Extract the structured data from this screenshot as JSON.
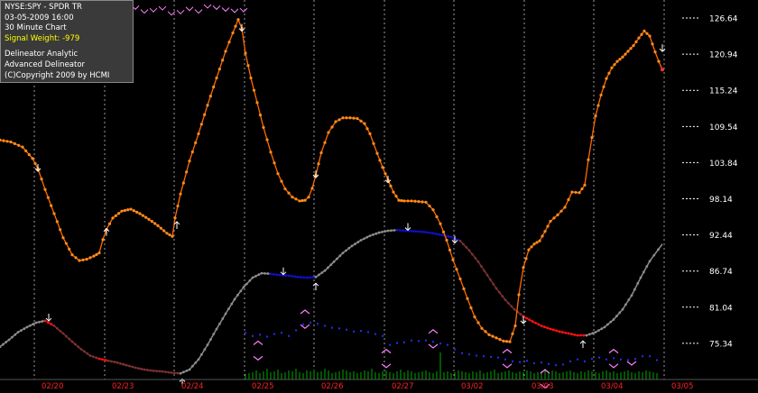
{
  "info": {
    "symbol": "NYSE:SPY - SPDR TR",
    "datetime": "03-05-2009  16:00",
    "interval": "30 Minute Chart",
    "signal_weight": "Signal Weight: -979",
    "line1": "Delineator Analytic",
    "line2": "Advanced Delineator",
    "copyright": "(C)Copyright 2009 by  HCMI"
  },
  "colors": {
    "background": "#000000",
    "price": "#ff6a00",
    "price_marker": "#ff8c1a",
    "delineator_grey": "#8c8c8c",
    "delineator_blue": "#1010c8",
    "delineator_red": "#ff1010",
    "delineator_brown": "#7a3030",
    "date_label": "#ff2020",
    "volume": "#00aa00",
    "arrow": "#ffffff",
    "chevron": "#ff80ff"
  },
  "chart_data": {
    "type": "line",
    "y_ticks": [
      "126.64",
      "120.94",
      "115.24",
      "109.54",
      "103.84",
      "98.14",
      "92.44",
      "86.74",
      "81.04",
      "75.34"
    ],
    "ylim": [
      69.64,
      129.49
    ],
    "xlim": [
      0,
      740
    ],
    "x_labels": [
      "02/20",
      "02/23",
      "02/24",
      "02/25",
      "02/26",
      "02/27",
      "03/02",
      "03/03",
      "03/04",
      "03/05"
    ],
    "day_boundaries": [
      38,
      116,
      193,
      271,
      348,
      426,
      503,
      581,
      658,
      736
    ],
    "price_series": {
      "x": [
        0,
        12,
        25,
        36,
        42,
        50,
        60,
        70,
        80,
        88,
        96,
        104,
        110,
        114,
        118,
        125,
        135,
        145,
        155,
        165,
        175,
        185,
        191,
        194,
        200,
        210,
        220,
        230,
        240,
        250,
        258,
        264,
        268,
        272,
        278,
        285,
        292,
        300,
        308,
        316,
        324,
        332,
        338,
        342,
        346,
        350,
        356,
        364,
        372,
        380,
        388,
        396,
        404,
        410,
        418,
        424,
        430,
        436,
        442,
        448,
        456,
        464,
        472,
        480,
        488,
        495,
        502,
        510,
        518,
        526,
        534,
        542,
        550,
        558,
        565,
        571,
        575,
        580,
        586,
        592,
        598,
        604,
        610,
        618,
        626,
        634,
        642,
        648,
        652,
        656,
        660,
        666,
        672,
        678,
        684,
        690,
        696,
        702,
        708,
        714,
        720,
        726,
        730,
        734
      ],
      "y": [
        107.4,
        107.1,
        106.3,
        104.5,
        102.9,
        99.6,
        95.8,
        92.0,
        89.3,
        88.4,
        88.6,
        89.1,
        89.6,
        91.7,
        93.3,
        95.1,
        96.2,
        96.5,
        95.8,
        94.9,
        93.9,
        92.7,
        92.2,
        95.1,
        98.9,
        104.1,
        108.4,
        112.9,
        117.2,
        121.4,
        124.3,
        126.4,
        125.0,
        121.1,
        117.2,
        113.3,
        109.4,
        105.5,
        102.1,
        99.7,
        98.4,
        97.8,
        97.9,
        98.4,
        99.8,
        101.9,
        105.4,
        108.6,
        110.3,
        110.9,
        110.9,
        110.8,
        110.0,
        108.4,
        105.3,
        103.1,
        101.1,
        99.2,
        97.9,
        97.8,
        97.8,
        97.7,
        97.6,
        96.4,
        94.2,
        91.6,
        88.5,
        85.5,
        82.4,
        79.5,
        77.7,
        76.7,
        76.2,
        75.7,
        75.6,
        78.1,
        83.0,
        87.3,
        90.1,
        91.0,
        91.5,
        93.0,
        94.6,
        95.6,
        96.8,
        99.2,
        99.1,
        100.3,
        104.3,
        107.8,
        111.2,
        114.5,
        117.1,
        118.8,
        119.8,
        120.5,
        121.4,
        122.3,
        123.5,
        124.6,
        123.8,
        121.3,
        119.8,
        118.5
      ]
    },
    "delineator_series": {
      "x": [
        0,
        10,
        20,
        30,
        40,
        50,
        60,
        70,
        80,
        90,
        100,
        110,
        120,
        130,
        140,
        150,
        160,
        170,
        180,
        190,
        200,
        210,
        220,
        230,
        240,
        250,
        260,
        270,
        280,
        290,
        300,
        310,
        320,
        330,
        340,
        350,
        360,
        370,
        380,
        390,
        400,
        410,
        420,
        430,
        440,
        450,
        460,
        470,
        480,
        490,
        500,
        510,
        520,
        530,
        540,
        550,
        560,
        570,
        580,
        590,
        600,
        610,
        620,
        630,
        640,
        650,
        660,
        670,
        680,
        690,
        700,
        710,
        720,
        734
      ],
      "y": [
        74.8,
        75.9,
        77.1,
        77.9,
        78.6,
        78.9,
        78.1,
        76.9,
        75.6,
        74.4,
        73.4,
        72.9,
        72.6,
        72.3,
        71.9,
        71.5,
        71.2,
        71.0,
        70.9,
        70.7,
        70.6,
        71.2,
        72.8,
        75.1,
        77.6,
        80.0,
        82.3,
        84.2,
        85.7,
        86.4,
        86.3,
        86.1,
        86.0,
        85.8,
        85.7,
        85.8,
        86.8,
        88.2,
        89.6,
        90.7,
        91.6,
        92.3,
        92.8,
        93.1,
        93.2,
        93.1,
        93.0,
        92.9,
        92.7,
        92.4,
        92.1,
        91.5,
        90.0,
        88.2,
        86.1,
        84.0,
        82.2,
        80.7,
        79.6,
        78.8,
        78.1,
        77.6,
        77.2,
        76.9,
        76.6,
        76.6,
        77.1,
        77.9,
        79.1,
        80.7,
        82.9,
        85.7,
        88.3,
        91.0
      ],
      "segment_colors": [
        "#8c8c8c",
        "#8c8c8c",
        "#8c8c8c",
        "#8c8c8c",
        "#8c8c8c",
        "#ff1010",
        "#7a3030",
        "#7a3030",
        "#7a3030",
        "#7a3030",
        "#7a3030",
        "#ff1010",
        "#7a3030",
        "#7a3030",
        "#7a3030",
        "#7a3030",
        "#7a3030",
        "#7a3030",
        "#7a3030",
        "#7a3030",
        "#8c8c8c",
        "#8c8c8c",
        "#8c8c8c",
        "#8c8c8c",
        "#8c8c8c",
        "#8c8c8c",
        "#8c8c8c",
        "#8c8c8c",
        "#8c8c8c",
        "#8c8c8c",
        "#1010c8",
        "#1010c8",
        "#1010c8",
        "#1010c8",
        "#1010c8",
        "#8c8c8c",
        "#8c8c8c",
        "#8c8c8c",
        "#8c8c8c",
        "#8c8c8c",
        "#8c8c8c",
        "#8c8c8c",
        "#8c8c8c",
        "#8c8c8c",
        "#1010c8",
        "#1010c8",
        "#1010c8",
        "#1010c8",
        "#1010c8",
        "#1010c8",
        "#1010c8",
        "#7a3030",
        "#7a3030",
        "#7a3030",
        "#7a3030",
        "#7a3030",
        "#7a3030",
        "#7a3030",
        "#ff1010",
        "#ff1010",
        "#ff1010",
        "#ff1010",
        "#ff1010",
        "#ff1010",
        "#ff1010",
        "#8c8c8c",
        "#8c8c8c",
        "#8c8c8c",
        "#8c8c8c",
        "#8c8c8c",
        "#8c8c8c",
        "#8c8c8c",
        "#8c8c8c"
      ]
    },
    "blue_dots": {
      "x": [
        272,
        280,
        288,
        296,
        304,
        312,
        320,
        328,
        336,
        344,
        352,
        360,
        368,
        376,
        384,
        392,
        400,
        408,
        416,
        424,
        432,
        440,
        448,
        456,
        464,
        472,
        480,
        488,
        496,
        504,
        512,
        520,
        528,
        536,
        544,
        552,
        560,
        568,
        576,
        584,
        592,
        600,
        608,
        616,
        624,
        632,
        640,
        648,
        656,
        664,
        672,
        680,
        688,
        696,
        704,
        712,
        720,
        728
      ],
      "y": [
        77.0,
        76.5,
        76.7,
        76.4,
        76.8,
        77.0,
        76.5,
        77.4,
        78.3,
        78.6,
        78.4,
        78.1,
        77.8,
        77.7,
        77.5,
        77.2,
        77.3,
        77.1,
        76.8,
        76.5,
        75.1,
        75.4,
        75.5,
        75.8,
        75.7,
        75.8,
        75.6,
        75.3,
        75.1,
        74.4,
        73.8,
        73.6,
        73.4,
        73.3,
        73.2,
        73.1,
        72.8,
        72.5,
        72.4,
        72.6,
        72.2,
        72.3,
        72.1,
        71.9,
        72.0,
        72.5,
        72.8,
        72.5,
        72.9,
        73.1,
        72.8,
        73.0,
        72.8,
        72.7,
        72.9,
        73.3,
        73.3,
        72.7
      ]
    },
    "volume": {
      "x": [
        272,
        276,
        280,
        284,
        288,
        292,
        296,
        300,
        304,
        308,
        312,
        316,
        320,
        324,
        328,
        332,
        336,
        340,
        344,
        348,
        352,
        356,
        360,
        364,
        368,
        372,
        376,
        380,
        384,
        388,
        392,
        396,
        400,
        404,
        408,
        412,
        416,
        420,
        424,
        428,
        432,
        436,
        440,
        444,
        448,
        452,
        456,
        460,
        464,
        468,
        472,
        476,
        480,
        484,
        488,
        492,
        496,
        500,
        504,
        508,
        512,
        516,
        520,
        524,
        528,
        532,
        536,
        540,
        544,
        548,
        552,
        556,
        560,
        564,
        568,
        572,
        576,
        580,
        584,
        588,
        592,
        596,
        600,
        604,
        608,
        612,
        616,
        620,
        624,
        628,
        632,
        636,
        640,
        644,
        648,
        652,
        656,
        660,
        664,
        668,
        672,
        676,
        680,
        684,
        688,
        692,
        696,
        700,
        704,
        708,
        712,
        716,
        720,
        724,
        728
      ],
      "h": [
        6,
        7,
        8,
        10,
        7,
        9,
        12,
        8,
        9,
        11,
        7,
        8,
        10,
        9,
        12,
        8,
        7,
        10,
        9,
        11,
        8,
        9,
        12,
        10,
        7,
        8,
        9,
        11,
        10,
        8,
        9,
        7,
        8,
        10,
        9,
        12,
        8,
        7,
        9,
        10,
        8,
        7,
        9,
        11,
        8,
        10,
        9,
        7,
        8,
        9,
        10,
        8,
        7,
        9,
        30,
        8,
        9,
        7,
        8,
        10,
        9,
        8,
        7,
        9,
        8,
        10,
        7,
        8,
        9,
        11,
        7,
        8,
        9,
        10,
        8,
        7,
        9,
        8,
        10,
        9,
        7,
        8,
        9,
        12,
        8,
        10,
        9,
        7,
        8,
        9,
        10,
        8,
        7,
        9,
        8,
        10,
        9,
        8,
        7,
        9,
        10,
        8,
        9,
        7,
        8,
        9,
        10,
        8,
        7,
        9,
        8,
        10,
        9,
        8,
        7
      ]
    },
    "arrows_down": [
      [
        42,
        102.9
      ],
      [
        268,
        125.0
      ],
      [
        350,
        101.9
      ],
      [
        430,
        101.1
      ],
      [
        504,
        91.6
      ],
      [
        580,
        78.9
      ],
      [
        734,
        121.8
      ],
      [
        54,
        79.3
      ],
      [
        314,
        86.6
      ],
      [
        452,
        93.6
      ]
    ],
    "arrows_up": [
      [
        118,
        93.0
      ],
      [
        196,
        94.1
      ],
      [
        202,
        69.3
      ],
      [
        350,
        84.4
      ],
      [
        646,
        75.3
      ]
    ],
    "chevrons_up": [
      [
        286,
        75.4
      ],
      [
        338,
        80.3
      ],
      [
        428,
        74.1
      ],
      [
        480,
        77.2
      ],
      [
        562,
        74.1
      ],
      [
        604,
        70.9
      ],
      [
        680,
        74.1
      ]
    ],
    "chevrons_down": [
      [
        286,
        73.0
      ],
      [
        338,
        78.0
      ],
      [
        428,
        71.8
      ],
      [
        480,
        74.9
      ],
      [
        562,
        71.8
      ],
      [
        604,
        68.6
      ],
      [
        680,
        71.8
      ],
      [
        700,
        72.2
      ]
    ],
    "top_ticks": {
      "x": [
        150,
        160,
        170,
        180,
        190,
        200,
        210,
        220,
        230,
        240,
        250,
        260,
        270
      ],
      "y": [
        128.3,
        127.7,
        127.9,
        128.2,
        127.4,
        127.6,
        128.1,
        127.7,
        128.5,
        128.3,
        128.0,
        127.8,
        127.9
      ]
    }
  }
}
